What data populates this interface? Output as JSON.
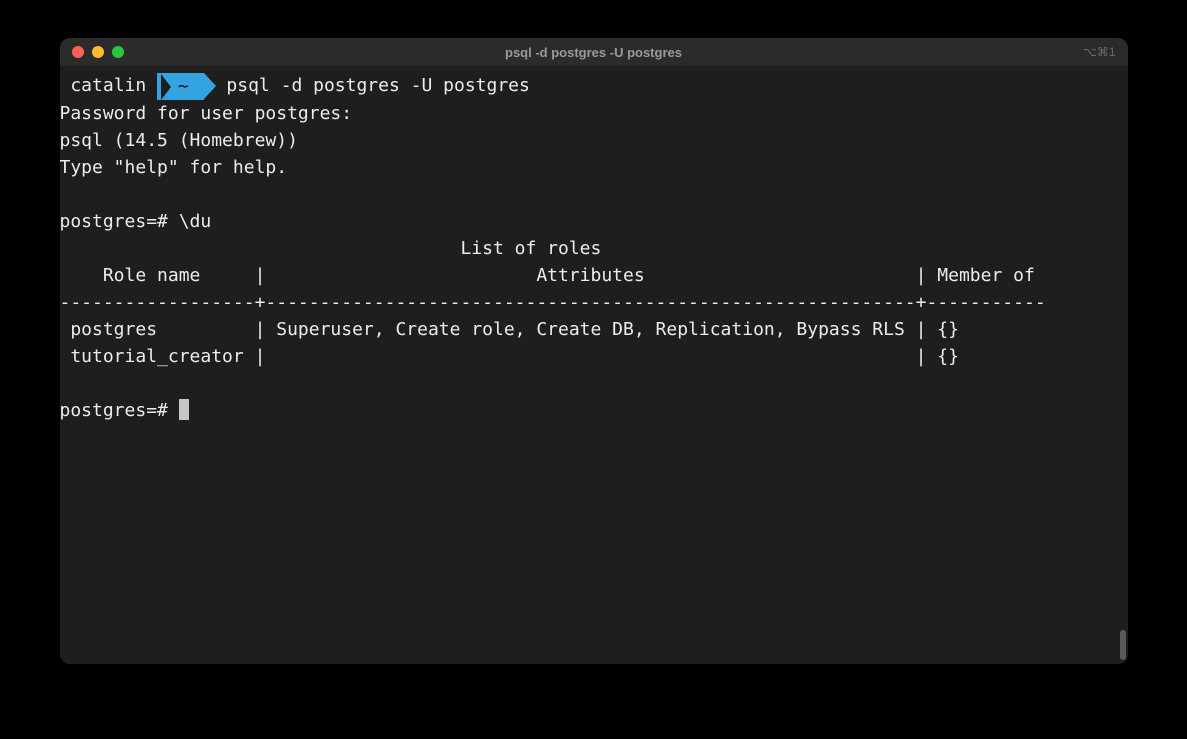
{
  "window": {
    "title": "psql -d postgres -U postgres",
    "shortcut_hint": "⌥⌘1"
  },
  "prompt": {
    "user": "catalin",
    "dir": "~",
    "command": "psql -d postgres -U postgres"
  },
  "output": {
    "password_line": "Password for user postgres:",
    "version_line": "psql (14.5 (Homebrew))",
    "help_line": "Type \"help\" for help.",
    "psql_prompt1": "postgres=# \\du",
    "table_title": "                                     List of roles",
    "table_header": "    Role name     |                         Attributes                         | Member of",
    "table_divider": "------------------+------------------------------------------------------------+-----------",
    "table_rows": [
      " postgres         | Superuser, Create role, Create DB, Replication, Bypass RLS | {}",
      " tutorial_creator |                                                            | {}"
    ],
    "psql_prompt2": "postgres=# "
  }
}
